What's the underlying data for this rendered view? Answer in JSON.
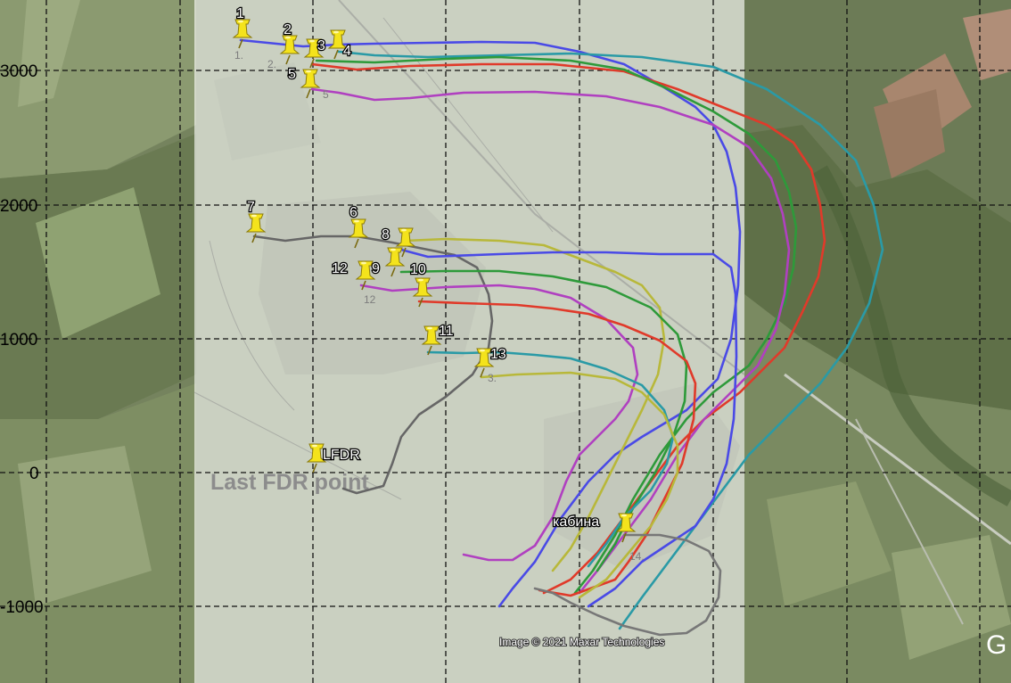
{
  "map": {
    "credit": "Image © 2021 Maxar Technologies",
    "provider_logo": "G",
    "annotation": "Last FDR point",
    "y_axis_labels": [
      "3000",
      "2000",
      "1000",
      "0",
      "-1000"
    ],
    "grid": "dashed black",
    "basemap": "satellite imagery with semi-transparent white overlay"
  },
  "markers": [
    {
      "label": "1",
      "icon": "yellow-pushpin-icon"
    },
    {
      "label": "2",
      "icon": "yellow-pushpin-icon"
    },
    {
      "label": "3",
      "icon": "yellow-pushpin-icon"
    },
    {
      "label": "4",
      "icon": "yellow-pushpin-icon"
    },
    {
      "label": "5",
      "icon": "yellow-pushpin-icon"
    },
    {
      "label": "6",
      "icon": "yellow-pushpin-icon"
    },
    {
      "label": "7",
      "icon": "yellow-pushpin-icon"
    },
    {
      "label": "8",
      "icon": "yellow-pushpin-icon"
    },
    {
      "label": "9",
      "icon": "yellow-pushpin-icon"
    },
    {
      "label": "10",
      "icon": "yellow-pushpin-icon"
    },
    {
      "label": "11",
      "icon": "yellow-pushpin-icon"
    },
    {
      "label": "12",
      "icon": "yellow-pushpin-icon"
    },
    {
      "label": "13",
      "icon": "yellow-pushpin-icon"
    },
    {
      "label": "LFDR",
      "icon": "yellow-pushpin-icon"
    },
    {
      "label": "кабина",
      "icon": "yellow-pushpin-icon"
    }
  ],
  "ghost_labels": [
    "1.",
    "2.",
    "5",
    "12",
    "3.",
    "14."
  ],
  "tracks": [
    {
      "color": "#4a4ae6"
    },
    {
      "color": "#2a9aa6"
    },
    {
      "color": "#e03a2a"
    },
    {
      "color": "#2e9a3a"
    },
    {
      "color": "#b040c0"
    },
    {
      "color": "#b8b83a"
    },
    {
      "color": "#666666"
    }
  ]
}
